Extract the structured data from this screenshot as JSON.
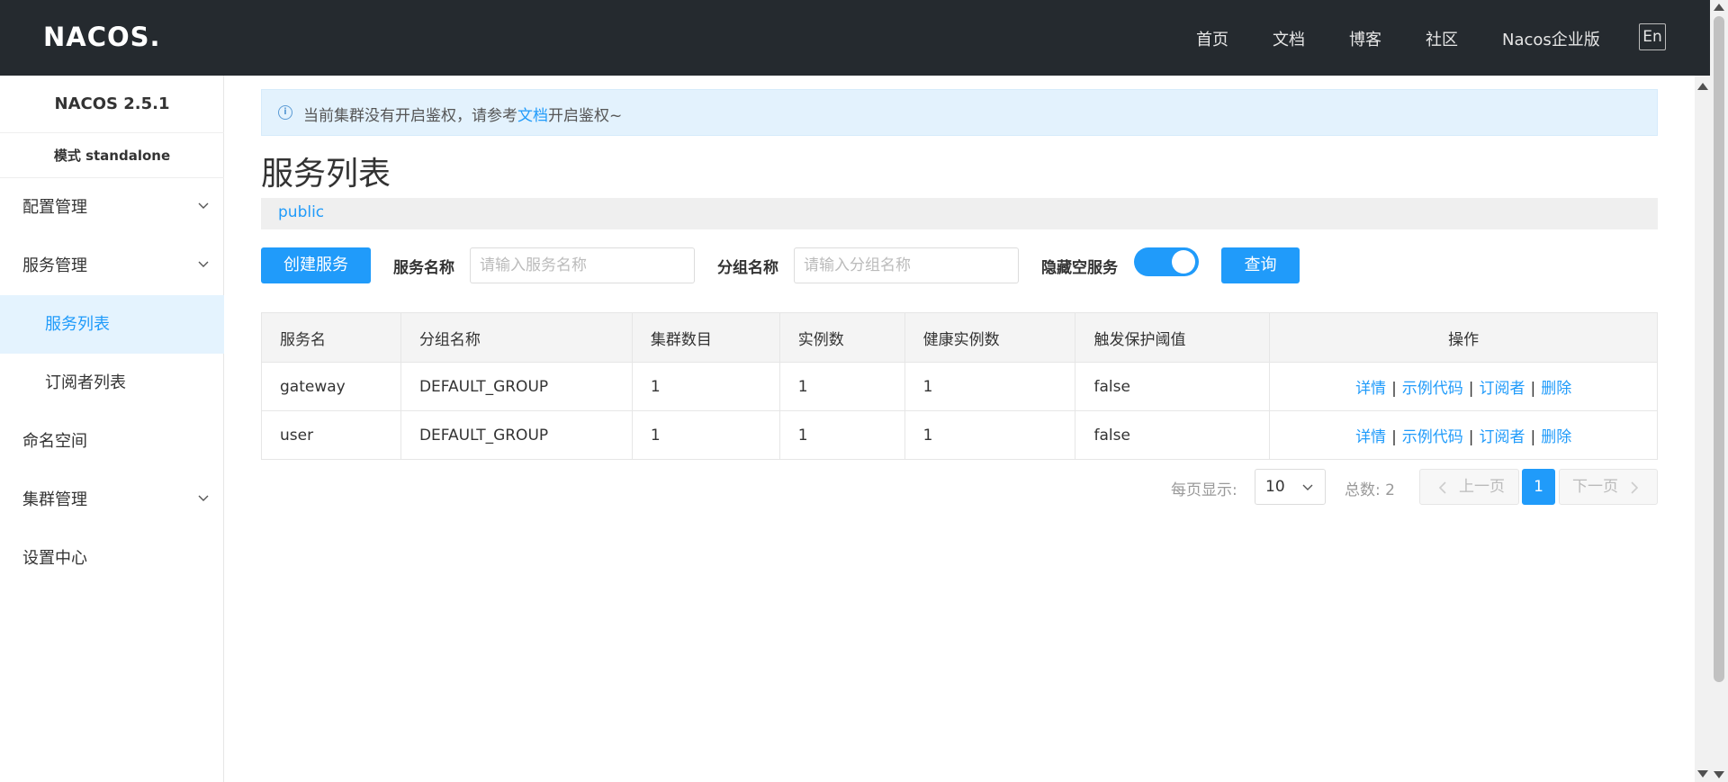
{
  "header": {
    "logo": "NACOS.",
    "nav": [
      "首页",
      "文档",
      "博客",
      "社区",
      "Nacos企业版"
    ],
    "lang": "En"
  },
  "sidebar": {
    "version": "NACOS 2.5.1",
    "mode": "模式 standalone",
    "items": [
      {
        "label": "配置管理",
        "expandable": true
      },
      {
        "label": "服务管理",
        "expandable": true
      },
      {
        "label": "服务列表",
        "sub": true,
        "active": true
      },
      {
        "label": "订阅者列表",
        "sub": true
      },
      {
        "label": "命名空间"
      },
      {
        "label": "集群管理",
        "expandable": true
      },
      {
        "label": "设置中心"
      }
    ]
  },
  "notice": {
    "before": "当前集群没有开启鉴权，请参考",
    "link": "文档",
    "after": "开启鉴权~"
  },
  "page": {
    "title": "服务列表",
    "namespace": "public"
  },
  "filters": {
    "create_button": "创建服务",
    "service_name_label": "服务名称",
    "service_name_placeholder": "请输入服务名称",
    "group_name_label": "分组名称",
    "group_name_placeholder": "请输入分组名称",
    "hide_empty_label": "隐藏空服务",
    "hide_empty_on": true,
    "query_button": "查询"
  },
  "table": {
    "columns": [
      "服务名",
      "分组名称",
      "集群数目",
      "实例数",
      "健康实例数",
      "触发保护阈值",
      "操作"
    ],
    "rows": [
      {
        "name": "gateway",
        "group": "DEFAULT_GROUP",
        "clusters": "1",
        "instances": "1",
        "healthy": "1",
        "threshold": "false"
      },
      {
        "name": "user",
        "group": "DEFAULT_GROUP",
        "clusters": "1",
        "instances": "1",
        "healthy": "1",
        "threshold": "false"
      }
    ],
    "actions": [
      "详情",
      "示例代码",
      "订阅者",
      "删除"
    ]
  },
  "pagination": {
    "page_size_label": "每页显示:",
    "page_size": "10",
    "total_label": "总数: 2",
    "prev": "上一页",
    "current": "1",
    "next": "下一页"
  },
  "colors": {
    "accent": "#209bfa",
    "topbar": "#252a2f",
    "notice_bg": "#e3f2fd"
  }
}
